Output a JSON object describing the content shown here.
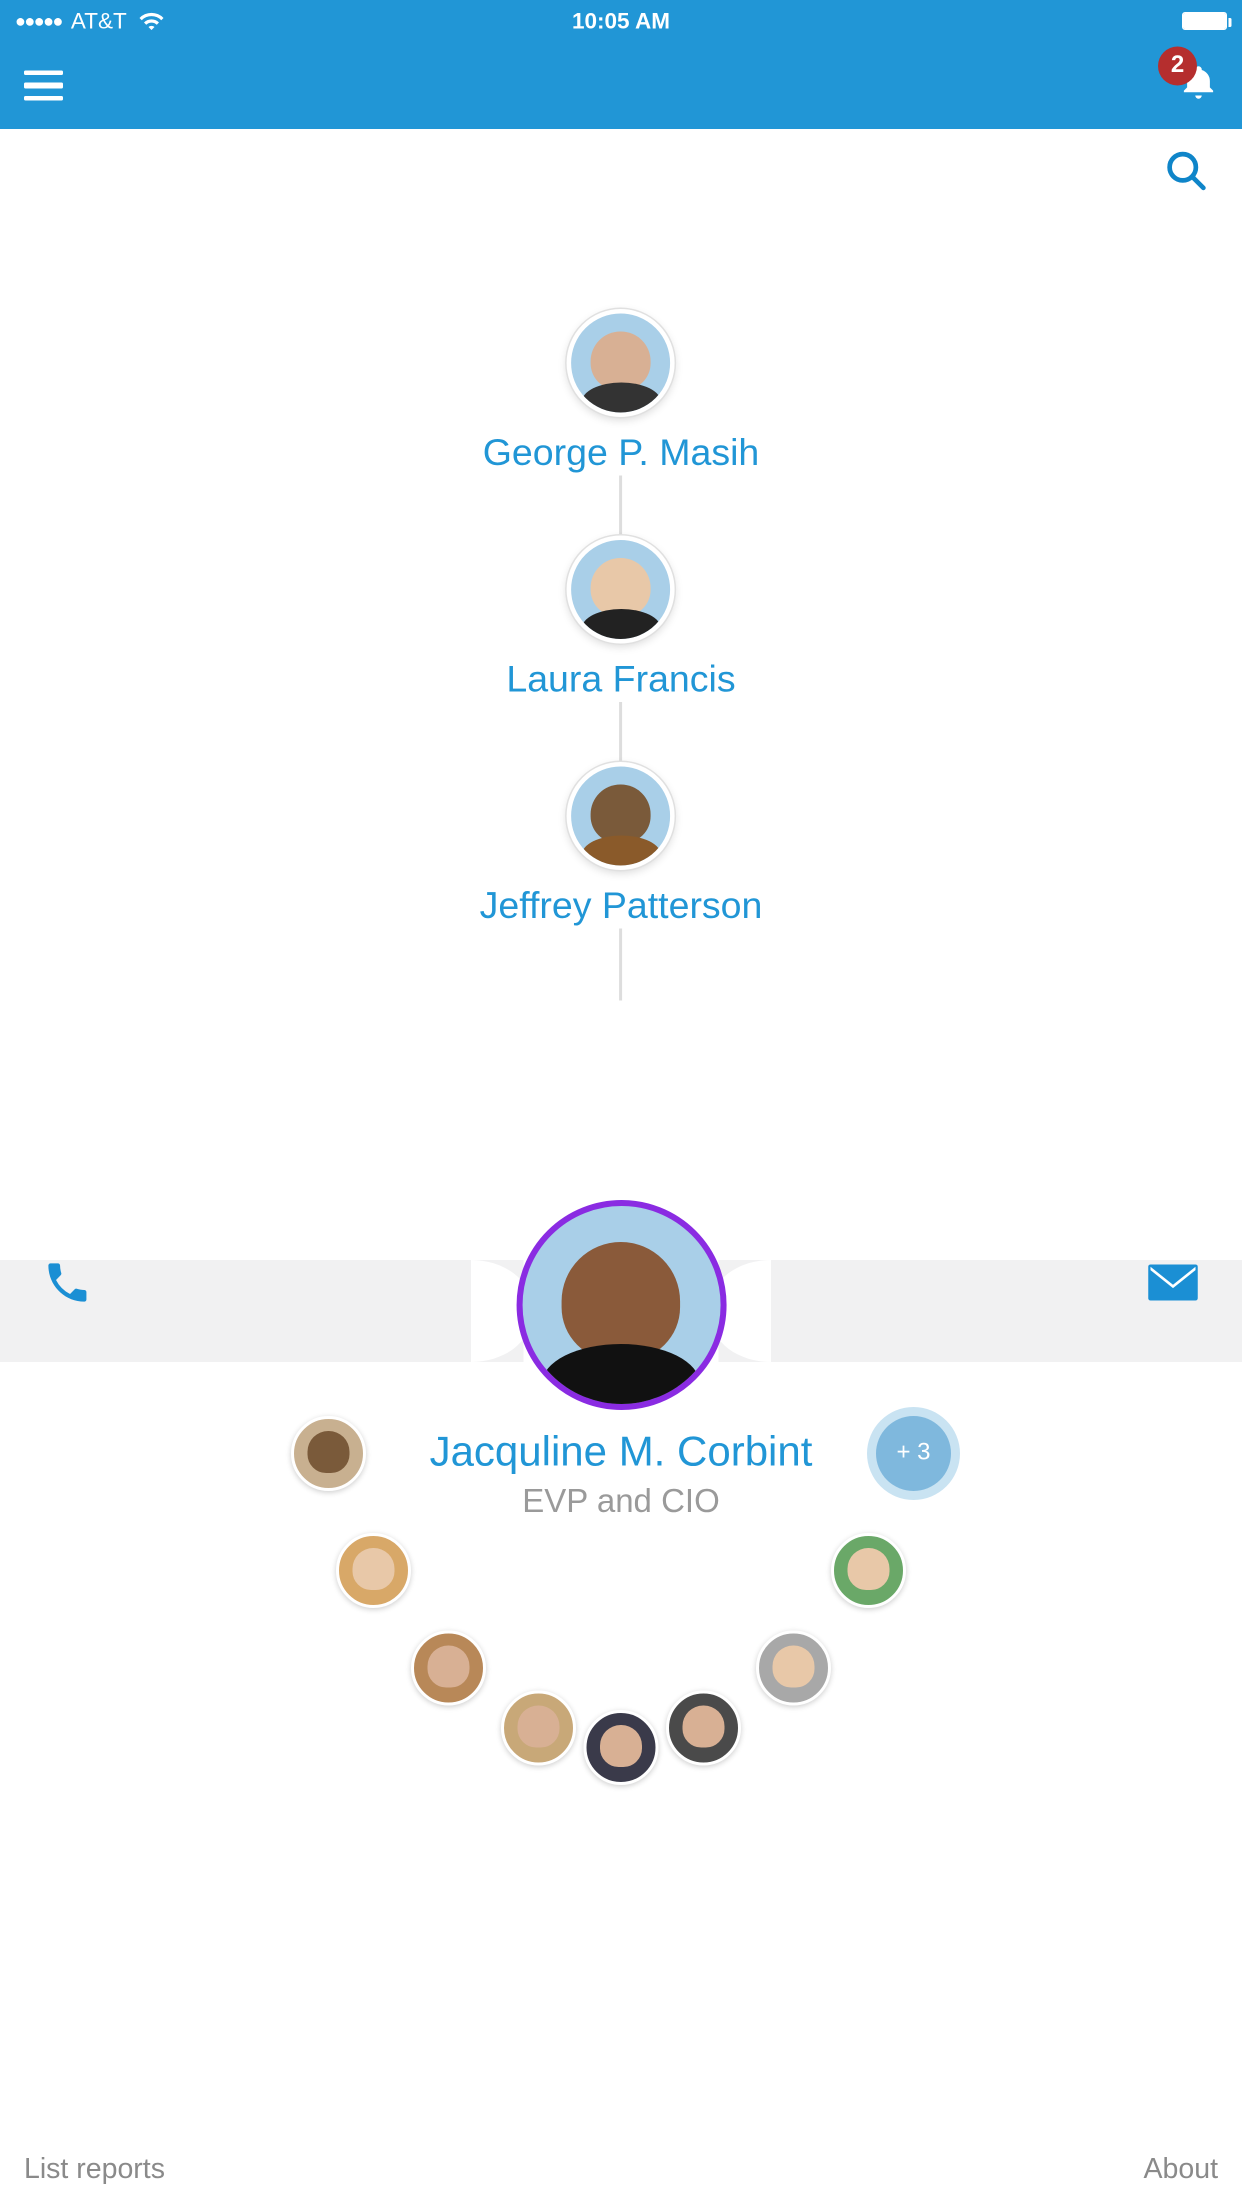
{
  "status": {
    "carrier": "AT&T",
    "time": "10:05 AM",
    "signal_dots": "●●●●●"
  },
  "header": {
    "notification_count": "2"
  },
  "chain": [
    {
      "name": "George P. Masih"
    },
    {
      "name": "Laura Francis"
    },
    {
      "name": "Jeffrey Patterson"
    }
  ],
  "focused": {
    "name": "Jacquline M. Corbint",
    "title": "EVP and CIO"
  },
  "more_reports_label": "+ 3",
  "bottom": {
    "list_reports": "List reports",
    "about": "About"
  }
}
